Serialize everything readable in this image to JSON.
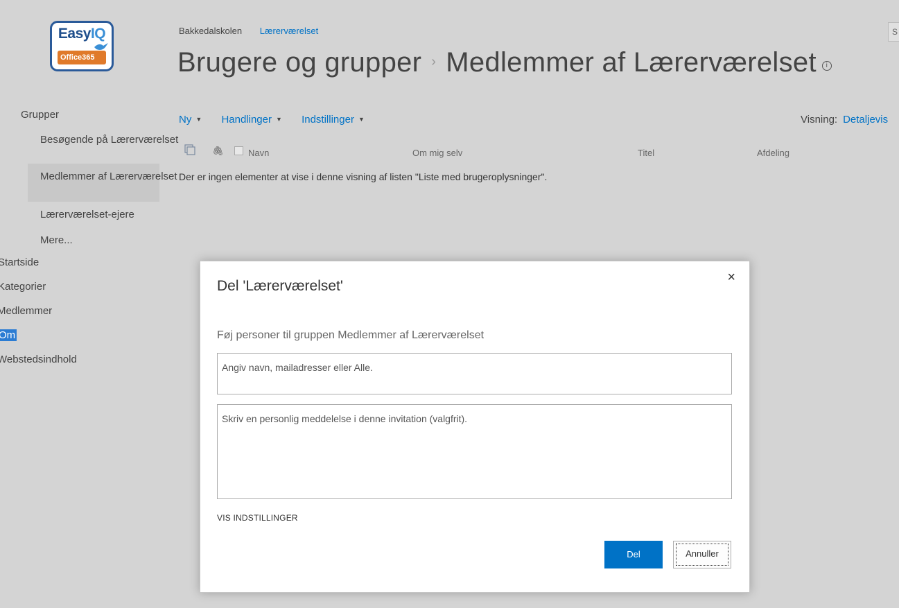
{
  "logo": {
    "top_text_a": "Easy",
    "top_text_b": "IQ",
    "bottom_text": "Office365"
  },
  "breadcrumb": {
    "site": "Bakkedalskolen",
    "current": "Lærerværelset"
  },
  "page_title": {
    "part1": "Brugere og grupper",
    "separator": "›",
    "part2": "Medlemmer af Lærerværelset",
    "info": "i"
  },
  "search_stub": "S",
  "nav": {
    "heading": "Grupper",
    "groups": [
      {
        "label": "Besøgende på Lærerværelset",
        "selected": false
      },
      {
        "label": "Medlemmer af Lærerværelset",
        "selected": true
      },
      {
        "label": "Lærerværelset-ejere",
        "selected": false
      },
      {
        "label": "Mere...",
        "selected": false
      }
    ],
    "root": [
      {
        "label": "Startside"
      },
      {
        "label": "Kategorier"
      },
      {
        "label": "Medlemmer"
      },
      {
        "label": "Om",
        "selected": true
      },
      {
        "label": "Webstedsindhold"
      }
    ]
  },
  "toolbar": {
    "new": "Ny",
    "actions": "Handlinger",
    "settings": "Indstillinger",
    "view_label": "Visning:",
    "view_value": "Detaljevis"
  },
  "columns": {
    "name": "Navn",
    "about": "Om mig selv",
    "title": "Titel",
    "department": "Afdeling"
  },
  "empty_message": "Der er ingen elementer at vise i denne visning af listen \"Liste med brugeroplysninger\".",
  "dialog": {
    "title": "Del 'Lærerværelset'",
    "close": "×",
    "subtitle": "Føj personer til gruppen Medlemmer af Lærerværelset",
    "people_placeholder": "Angiv navn, mailadresser eller Alle.",
    "message_placeholder": "Skriv en personlig meddelelse i denne invitation (valgfrit).",
    "show_options": "VIS INDSTILLINGER",
    "share_button": "Del",
    "cancel_button": "Annuller"
  },
  "colors": {
    "accent": "#0072c6",
    "backdrop": "#d4d4d4",
    "selected_nav": "#2b7cd3"
  }
}
